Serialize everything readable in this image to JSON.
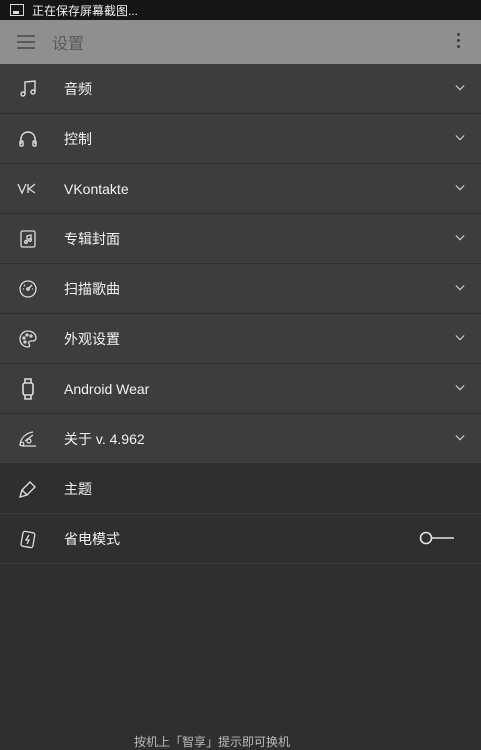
{
  "status_bar": {
    "text": "正在保存屏幕截图..."
  },
  "app_bar": {
    "title": "设置"
  },
  "expandable_items": [
    {
      "label": "音频",
      "icon": "music-note-icon"
    },
    {
      "label": "控制",
      "icon": "headphones-icon"
    },
    {
      "label": "VKontakte",
      "icon": "vk-icon"
    },
    {
      "label": "专辑封面",
      "icon": "album-art-icon"
    },
    {
      "label": "扫描歌曲",
      "icon": "scan-icon"
    },
    {
      "label": "外观设置",
      "icon": "palette-icon"
    },
    {
      "label": "Android Wear",
      "icon": "watch-icon"
    },
    {
      "label": "关于 v. 4.962",
      "icon": "about-icon"
    }
  ],
  "plain_items": [
    {
      "label": "主题",
      "icon": "brush-icon"
    },
    {
      "label": "省电模式",
      "icon": "battery-saver-icon",
      "toggle": false
    }
  ],
  "bottom_text": "按机上「智享」提示即可换机"
}
